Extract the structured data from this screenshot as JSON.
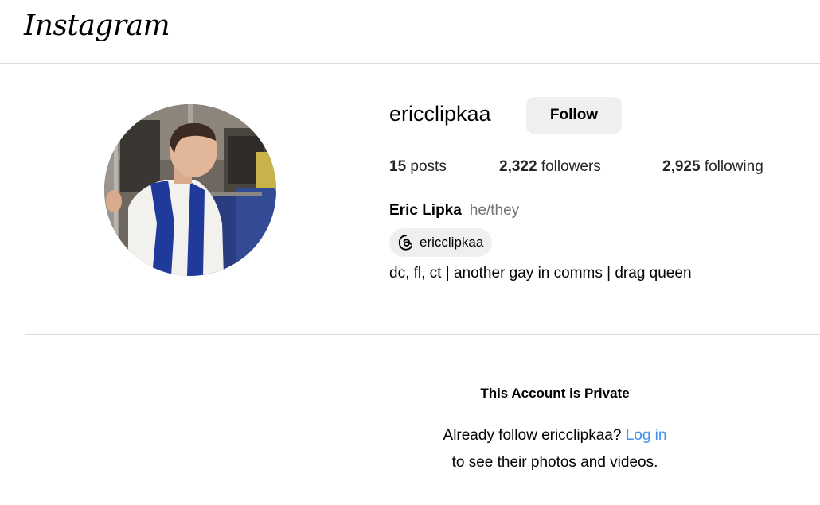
{
  "header": {
    "logo_text": "Instagram"
  },
  "profile": {
    "username": "ericclipkaa",
    "follow_label": "Follow",
    "stats": {
      "posts_count": "15",
      "posts_label": "posts",
      "followers_count": "2,322",
      "followers_label": "followers",
      "following_count": "2,925",
      "following_label": "following"
    },
    "full_name": "Eric Lipka",
    "pronouns": "he/they",
    "threads_handle": "ericclipkaa",
    "threads_icon": "threads-icon",
    "bio": "dc, fl, ct | another gay in comms | drag queen"
  },
  "private_notice": {
    "title": "This Account is Private",
    "line1_prefix": "Already follow ericclipkaa?",
    "login_label": "Log in",
    "line2": "to see their photos and videos."
  },
  "colors": {
    "link": "#4192ef",
    "button_bg": "#efefef",
    "muted_text": "#737373",
    "divider": "#dbdbdb"
  }
}
